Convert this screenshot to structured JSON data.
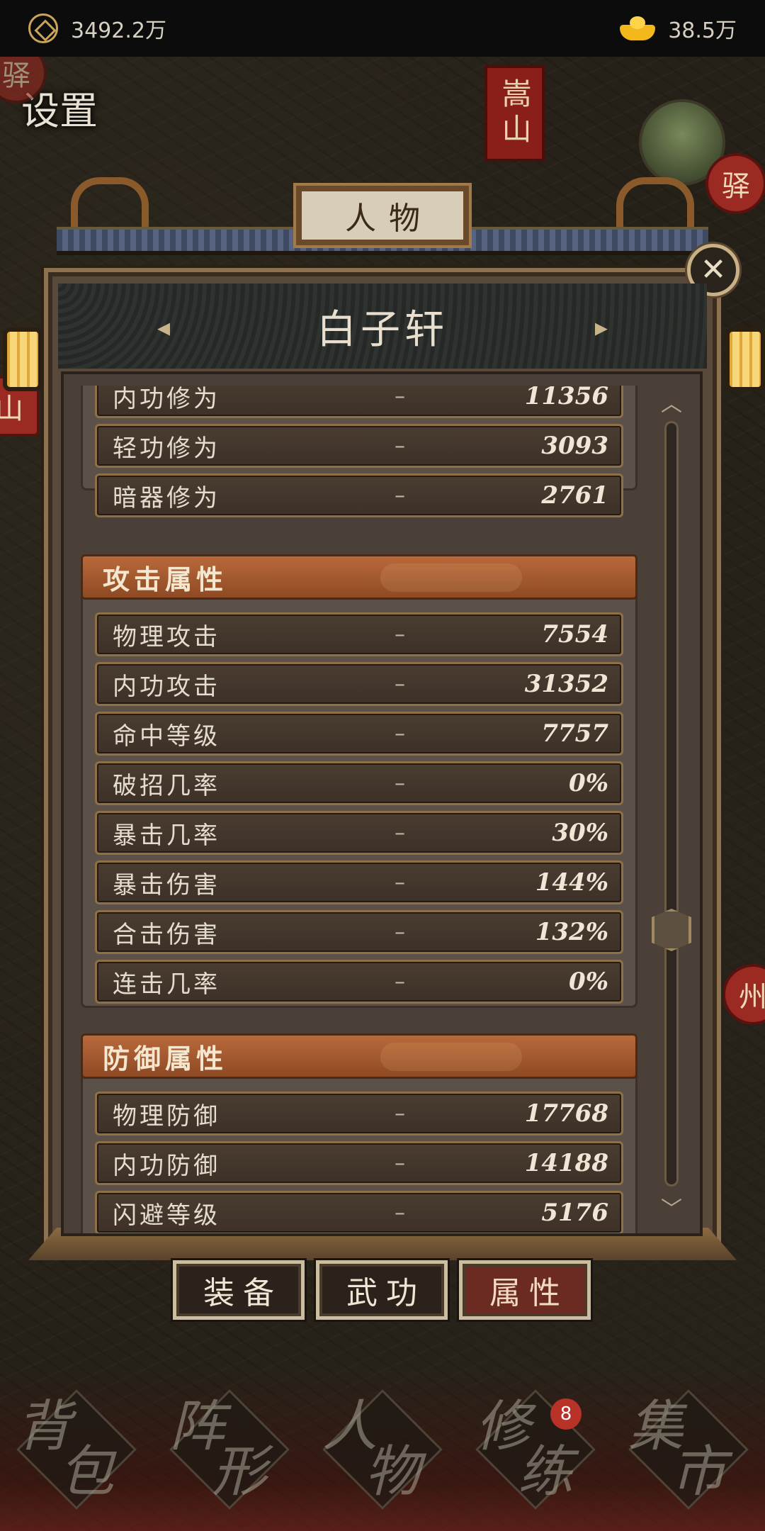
{
  "topbar": {
    "copper": "3492.2万",
    "gold": "38.5万"
  },
  "map": {
    "settings_label": "设置",
    "mountain_tag": "嵩山",
    "station_right": "驿",
    "station_left": "驿",
    "left_tag": "山",
    "right_tag": "州"
  },
  "panel": {
    "title": "人物",
    "character_name": "白子轩",
    "close_symbol": "✕",
    "prev_arrow": "◂",
    "next_arrow": "▸"
  },
  "stats": {
    "top_rows": [
      {
        "label": "内功修为",
        "dash": "–",
        "value": "11356"
      },
      {
        "label": "轻功修为",
        "dash": "–",
        "value": "3093"
      },
      {
        "label": "暗器修为",
        "dash": "–",
        "value": "2761"
      }
    ],
    "attack": {
      "title": "攻击属性",
      "rows": [
        {
          "label": "物理攻击",
          "dash": "–",
          "value": "7554"
        },
        {
          "label": "内功攻击",
          "dash": "–",
          "value": "31352"
        },
        {
          "label": "命中等级",
          "dash": "–",
          "value": "7757"
        },
        {
          "label": "破招几率",
          "dash": "–",
          "value": "0%"
        },
        {
          "label": "暴击几率",
          "dash": "–",
          "value": "30%"
        },
        {
          "label": "暴击伤害",
          "dash": "–",
          "value": "144%"
        },
        {
          "label": "合击伤害",
          "dash": "–",
          "value": "132%"
        },
        {
          "label": "连击几率",
          "dash": "–",
          "value": "0%"
        }
      ]
    },
    "defense": {
      "title": "防御属性",
      "rows": [
        {
          "label": "物理防御",
          "dash": "–",
          "value": "17768"
        },
        {
          "label": "内功防御",
          "dash": "–",
          "value": "14188"
        },
        {
          "label": "闪避等级",
          "dash": "–",
          "value": "5176"
        }
      ]
    }
  },
  "scroll": {
    "up": "︿",
    "down": "﹀",
    "position": 0.62
  },
  "tabs": [
    {
      "label": "装备",
      "active": false
    },
    {
      "label": "武功",
      "active": false
    },
    {
      "label": "属性",
      "active": true
    }
  ],
  "bottom_nav": [
    {
      "label_a": "背",
      "label_b": "包",
      "badge": ""
    },
    {
      "label_a": "阵",
      "label_b": "形",
      "badge": ""
    },
    {
      "label_a": "人",
      "label_b": "物",
      "badge": ""
    },
    {
      "label_a": "修",
      "label_b": "练",
      "badge": "8"
    },
    {
      "label_a": "集",
      "label_b": "市",
      "badge": ""
    }
  ],
  "colors": {
    "section_header": "#a35a2e",
    "row_border": "#8d7047",
    "active_tab": "#6b2a22",
    "badge": "#b83228"
  },
  "icons": [
    "copper-coin-icon",
    "gold-ingot-icon",
    "close-icon",
    "scroll-up-icon",
    "scroll-down-icon"
  ]
}
